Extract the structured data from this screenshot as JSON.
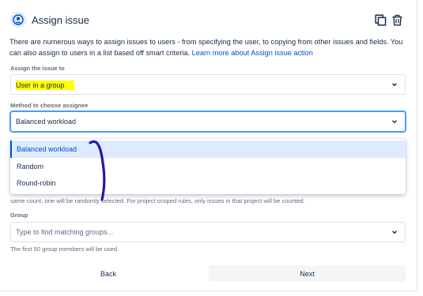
{
  "header": {
    "title": "Assign issue",
    "copy_icon": "copy-icon",
    "delete_icon": "trash-icon"
  },
  "description": {
    "text": "There are numerous ways to assign issues to users - from specifying the user, to copying from other issues and fields. You can also assign to users in a list based off smart criteria.",
    "link": "Learn more about Assign issue action"
  },
  "assign_field": {
    "label": "Assign the issue to",
    "value": "User in a group"
  },
  "method_field": {
    "label": "Method to choose assignee",
    "value": "Balanced workload",
    "options": [
      "Balanced workload",
      "Random",
      "Round-robin"
    ],
    "selected_index": 0
  },
  "partial_help_text": "same count, one will be randomly selected. For project scoped rules, only issues in that project will be counted.",
  "group_field": {
    "label": "Group",
    "placeholder": "Type to find matching groups...",
    "help": "The first 50 group members will be used."
  },
  "footer": {
    "back_label": "Back",
    "next_label": "Next"
  },
  "colors": {
    "accent": "#0052cc",
    "focus_border": "#4c9aff",
    "highlight": "#ffff00",
    "annotation_stroke": "#2b14a8"
  }
}
